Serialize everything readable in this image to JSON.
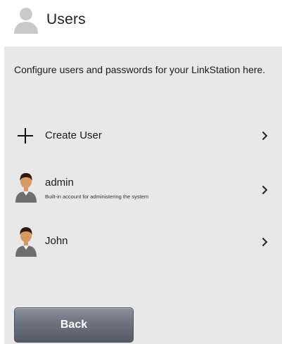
{
  "header": {
    "title": "Users",
    "icon": "user-silhouette-icon"
  },
  "intro": {
    "text": "Configure users and passwords for your LinkStation here."
  },
  "rows": [
    {
      "label": "Create User",
      "icon": "plus-icon"
    },
    {
      "label": "admin",
      "description": "Built-in account for administering the system",
      "icon": "user-avatar-icon"
    },
    {
      "label": "John",
      "icon": "user-avatar-icon"
    }
  ],
  "footer": {
    "back_label": "Back"
  },
  "colors": {
    "panel_background": "#e8e8e8",
    "button_gradient_top": "#8b929c",
    "button_gradient_bottom": "#565c66",
    "avatar_shirt": "#6e6e6e",
    "avatar_skin": "#d99a62",
    "avatar_hair": "#2b1a10"
  }
}
